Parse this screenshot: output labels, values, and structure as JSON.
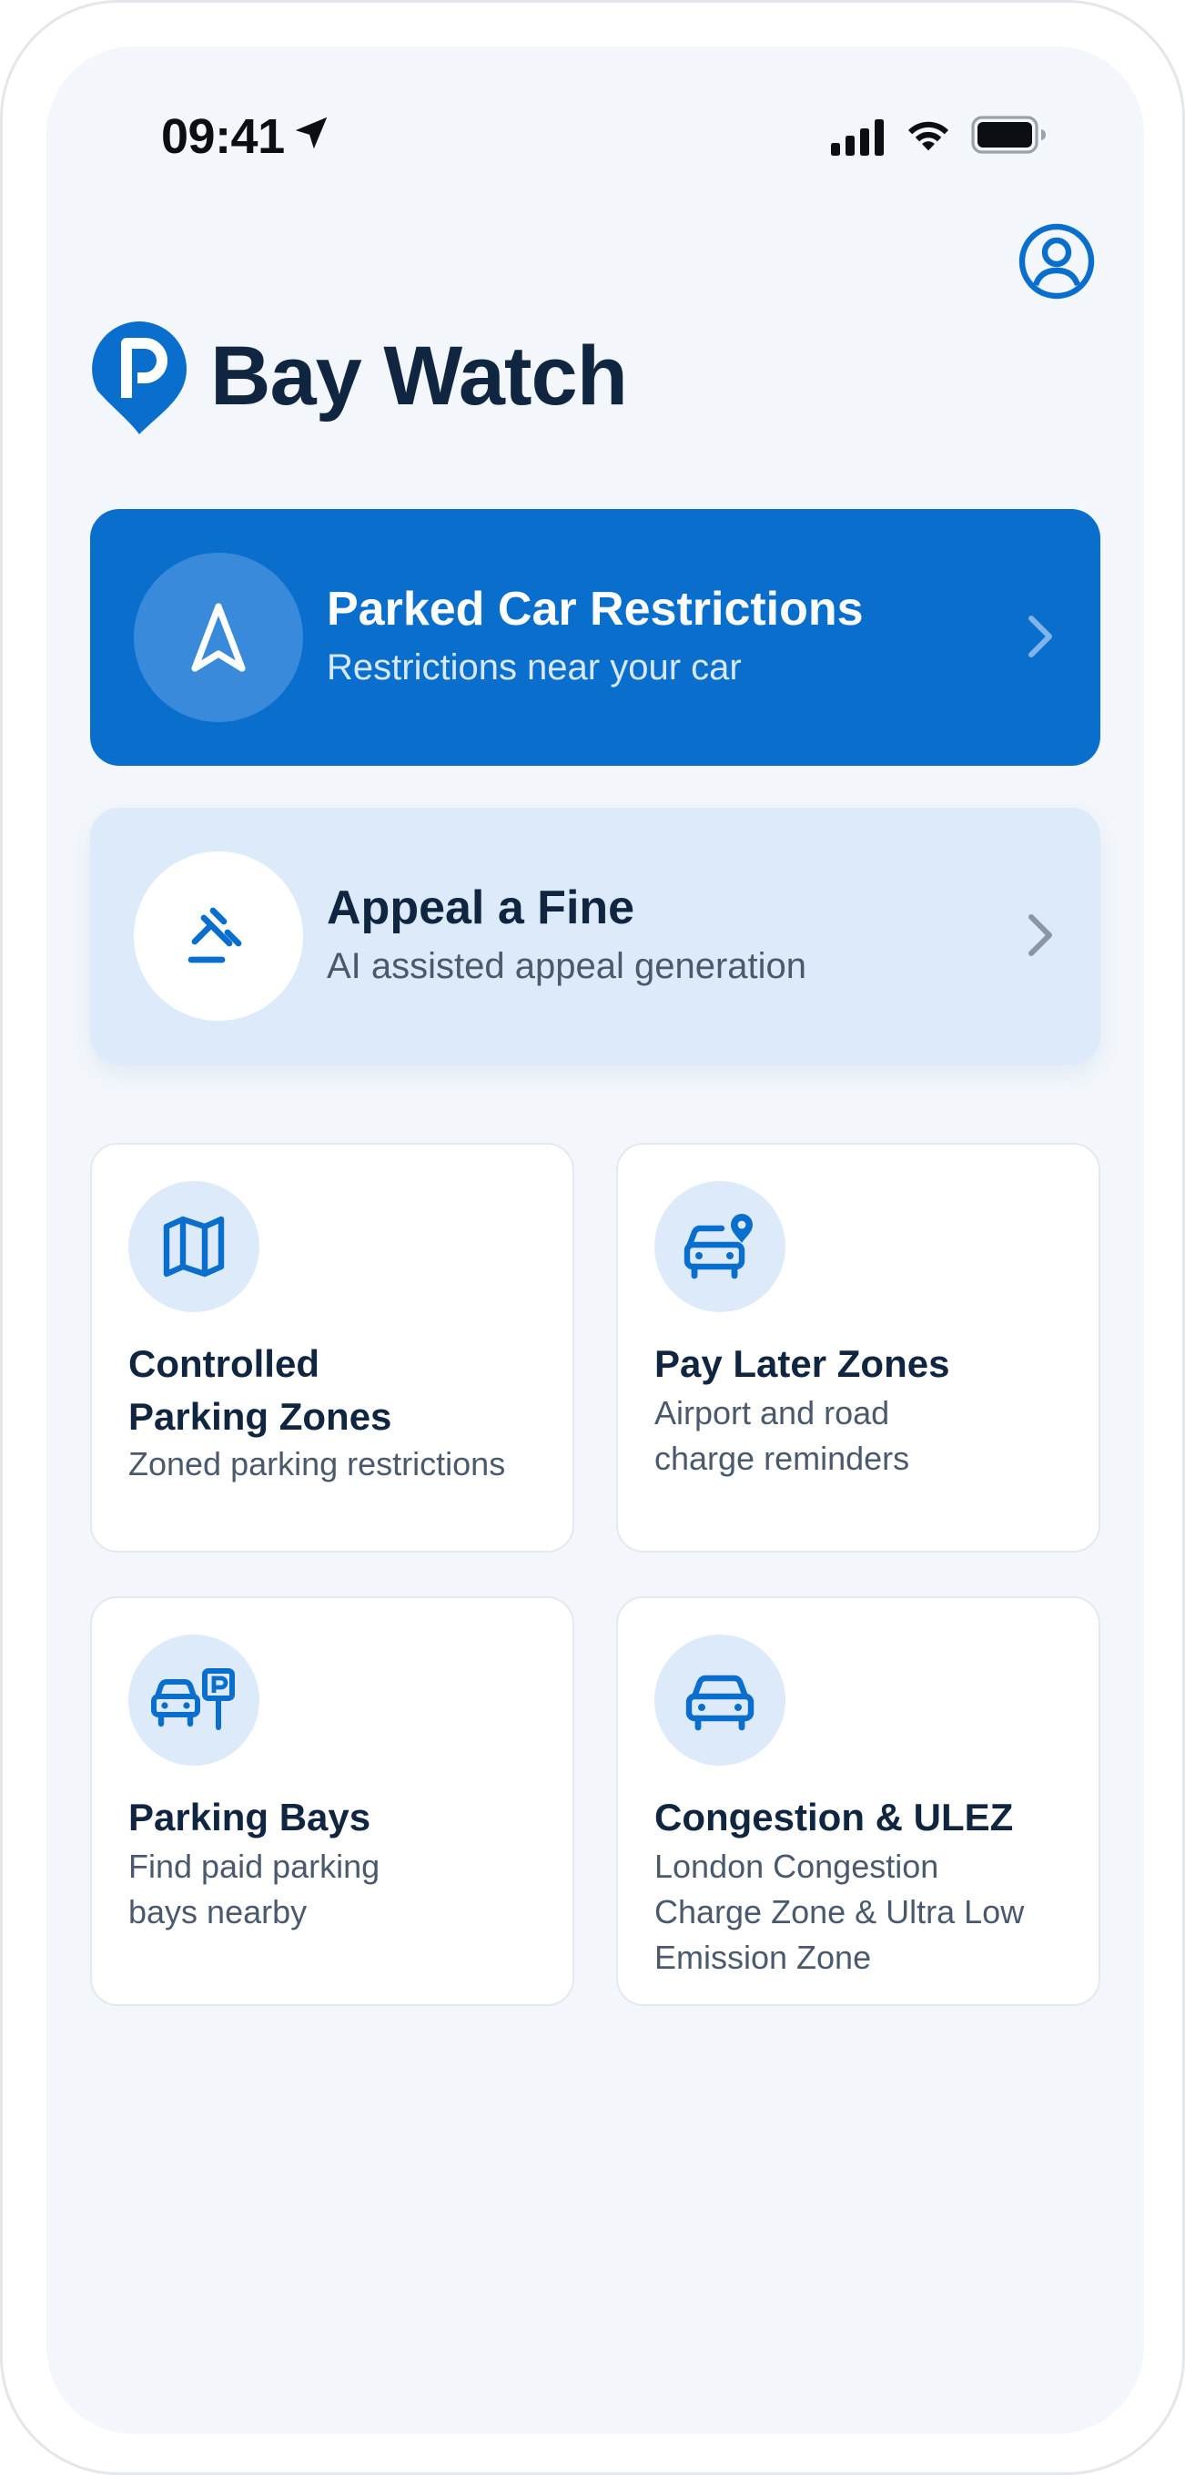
{
  "status_bar": {
    "time": "09:41"
  },
  "header": {
    "app_title": "Bay Watch",
    "logo_letter": "P",
    "profile_icon": "user-circle-icon"
  },
  "colors": {
    "primary": "#0a6ecd",
    "primary_light": "#ddeafa",
    "text_dark": "#0f2540",
    "text_muted": "#4a5a6c",
    "background": "#f3f7fc"
  },
  "cards": {
    "parked_car": {
      "title": "Parked Car Restrictions",
      "subtitle": "Restrictions near your car",
      "icon": "navigation-arrow-icon"
    },
    "appeal": {
      "title": "Appeal a Fine",
      "subtitle": "AI assisted appeal generation",
      "icon": "gavel-icon"
    }
  },
  "tiles": [
    {
      "title_lines": [
        "Controlled",
        "Parking Zones"
      ],
      "desc_lines": [
        "Zoned parking restrictions"
      ],
      "icon": "map-icon"
    },
    {
      "title_lines": [
        "Pay Later Zones"
      ],
      "desc_lines": [
        "Airport and road",
        "charge reminders"
      ],
      "icon": "car-location-pin-icon"
    },
    {
      "title_lines": [
        "Parking Bays"
      ],
      "desc_lines": [
        "Find paid parking",
        "bays nearby"
      ],
      "icon": "car-parking-sign-icon"
    },
    {
      "title_lines": [
        "Congestion & ULEZ"
      ],
      "desc_lines": [
        "London Congestion",
        "Charge Zone & Ultra Low",
        "Emission Zone"
      ],
      "icon": "car-icon"
    }
  ]
}
